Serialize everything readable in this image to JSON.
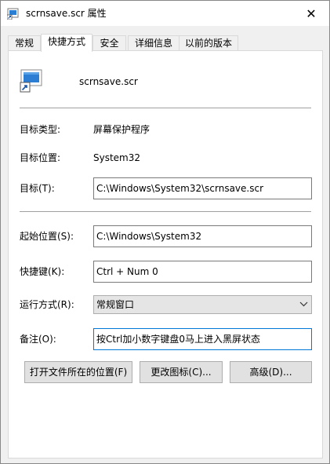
{
  "window": {
    "title": "scrnsave.scr 属性",
    "close_glyph": "✕"
  },
  "tabs": [
    {
      "label": "常规"
    },
    {
      "label": "快捷方式"
    },
    {
      "label": "安全"
    },
    {
      "label": "详细信息"
    },
    {
      "label": "以前的版本"
    }
  ],
  "file": {
    "name": "scrnsave.scr"
  },
  "fields": {
    "target_type_label": "目标类型:",
    "target_type_value": "屏幕保护程序",
    "target_location_label": "目标位置:",
    "target_location_value": "System32",
    "target_label": "目标(T):",
    "target_value": "C:\\Windows\\System32\\scrnsave.scr",
    "start_in_label": "起始位置(S):",
    "start_in_value": "C:\\Windows\\System32",
    "shortcut_key_label": "快捷键(K):",
    "shortcut_key_value": "Ctrl + Num 0",
    "run_label": "运行方式(R):",
    "run_value": "常规窗口",
    "comment_label": "备注(O):",
    "comment_value": "按Ctrl加小数字键盘0马上进入黑屏状态"
  },
  "buttons": {
    "open_location": "打开文件所在的位置(F)",
    "change_icon": "更改图标(C)...",
    "advanced": "高级(D)..."
  },
  "icons": {
    "title_icon": "shortcut-file-icon",
    "file_icon": "screensaver-shortcut-icon",
    "close": "close-icon",
    "dropdown": "chevron-down-icon"
  },
  "colors": {
    "focus_border": "#0078d7",
    "panel_bg": "#ffffff",
    "window_bg": "#f0f0f0"
  }
}
